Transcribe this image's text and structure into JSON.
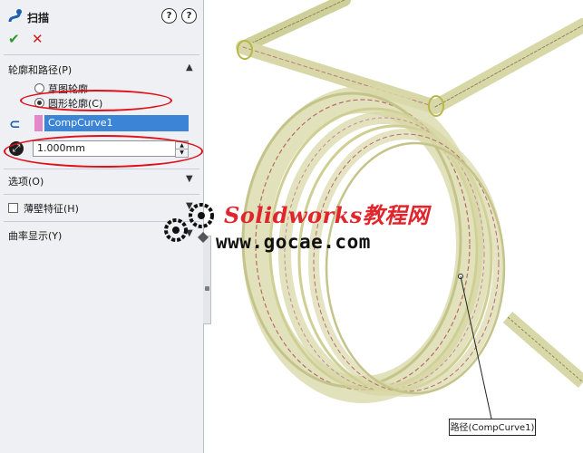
{
  "header": {
    "title": "扫描",
    "help_label": "?"
  },
  "actions": {
    "ok": "✔",
    "cancel": "✕"
  },
  "profile_path": {
    "title": "轮廓和路径(P)",
    "options": [
      {
        "label": "草图轮廓",
        "selected": false
      },
      {
        "label": "圆形轮廓(C)",
        "selected": true
      }
    ],
    "path_value": "CompCurve1",
    "diameter_value": "1.000mm"
  },
  "sections": {
    "options": "选项(O)",
    "thin_feature": "薄壁特征(H)",
    "curvature": "曲率显示(Y)"
  },
  "watermark": {
    "title": "Solidworks教程网",
    "url": "www.gocae.com"
  },
  "callout_label": "路径(CompCurve1)",
  "colors": {
    "highlight_red": "#e0101a",
    "selection_blue": "#3b84d6",
    "profile_pink": "#e487c9"
  }
}
